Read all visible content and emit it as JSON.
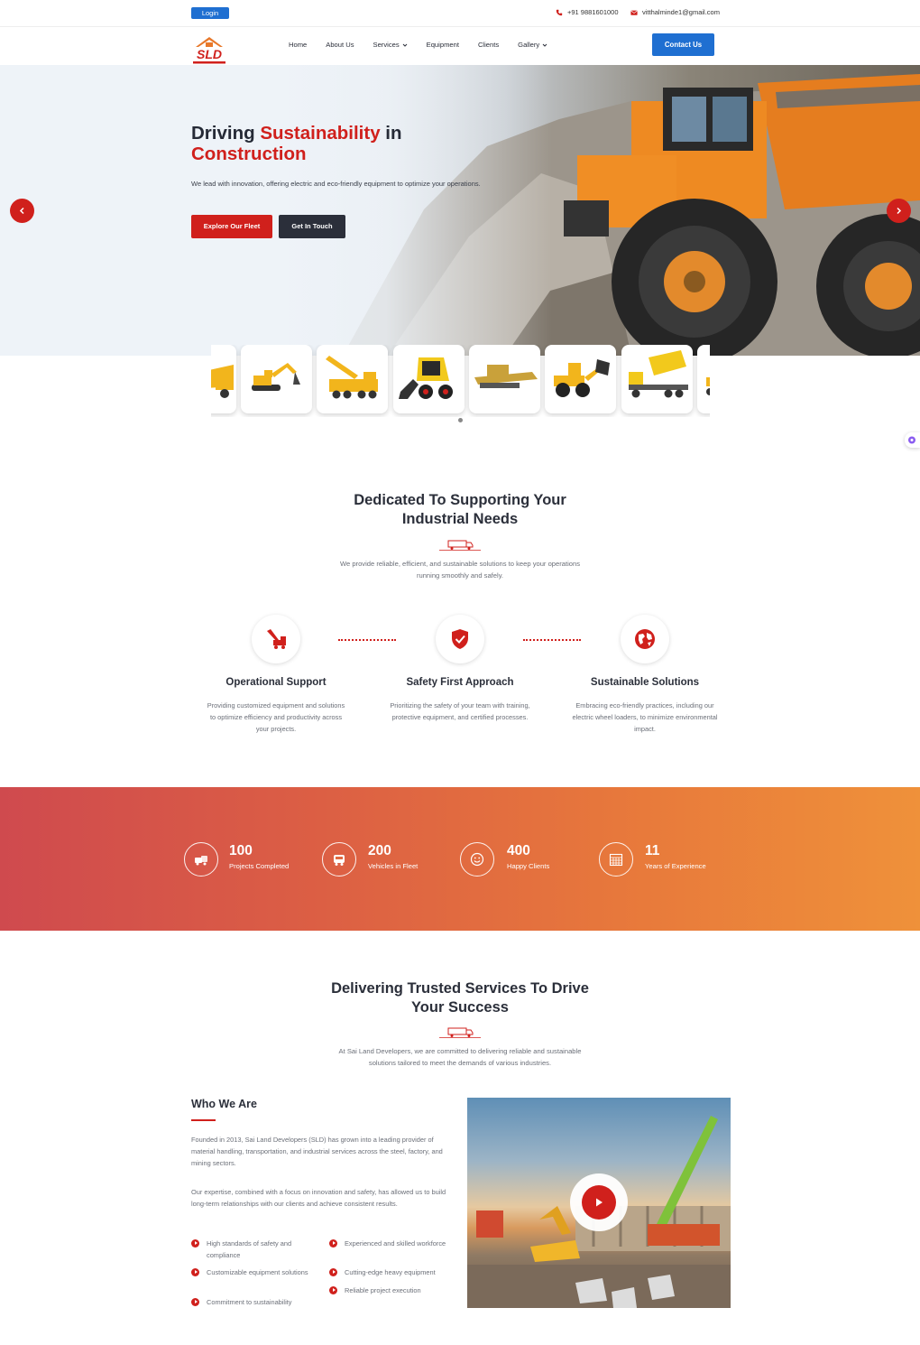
{
  "topbar": {
    "login_label": "Login",
    "phone": "+91 9881601000",
    "email": "vitthalminde1@gmail.com"
  },
  "nav": {
    "items": [
      {
        "label": "Home"
      },
      {
        "label": "About Us"
      },
      {
        "label": "Services",
        "dropdown": true
      },
      {
        "label": "Equipment"
      },
      {
        "label": "Clients"
      },
      {
        "label": "Gallery",
        "dropdown": true
      }
    ],
    "contact_label": "Contact Us"
  },
  "hero": {
    "title_part1": "Driving ",
    "title_highlight": "Sustainability",
    "title_part2": " in",
    "title_line2": "Construction",
    "subtitle": "We lead with innovation, offering electric and eco-friendly equipment to optimize your operations.",
    "primary_button": "Explore Our Fleet",
    "secondary_button": "Get In Touch"
  },
  "equipment_carousel": {
    "items": [
      "dump-truck",
      "excavator",
      "mobile-crane",
      "skid-steer-loader",
      "mobile-crusher",
      "wheel-loader",
      "tipper-truck",
      "dump-truck"
    ]
  },
  "support": {
    "title_line1": "Dedicated To Supporting Your",
    "title_line2": "Industrial Needs",
    "subtitle_line1": "We provide reliable, efficient, and sustainable solutions to keep your operations",
    "subtitle_line2": "running smoothly and safely.",
    "features": [
      {
        "icon": "crane-icon",
        "title": "Operational Support",
        "text": "Providing customized equipment and solutions to optimize efficiency and productivity across your projects."
      },
      {
        "icon": "shield-check-icon",
        "title": "Safety First Approach",
        "text": "Prioritizing the safety of your team with training, protective equipment, and certified processes."
      },
      {
        "icon": "globe-icon",
        "title": "Sustainable Solutions",
        "text": "Embracing eco-friendly practices, including our electric wheel loaders, to minimize environmental impact."
      }
    ]
  },
  "stats": [
    {
      "icon": "projects-icon",
      "number": "100",
      "label": "Projects Completed"
    },
    {
      "icon": "vehicle-icon",
      "number": "200",
      "label": "Vehicles in Fleet"
    },
    {
      "icon": "smile-icon",
      "number": "400",
      "label": "Happy Clients"
    },
    {
      "icon": "calendar-icon",
      "number": "11",
      "label": "Years of Experience"
    }
  ],
  "services": {
    "title_line1": "Delivering Trusted Services To Drive",
    "title_line2": "Your Success",
    "subtitle_line1": "At Sai Land Developers, we are committed to delivering reliable and sustainable",
    "subtitle_line2": "solutions tailored to meet the demands of various industries."
  },
  "who": {
    "title": "Who We Are",
    "para1": "Founded in 2013, Sai Land Developers (SLD) has grown into a leading provider of material handling, transportation, and industrial services across the steel, factory, and mining sectors.",
    "para2": "Our expertise, combined with a focus on innovation and safety, has allowed us to build long-term relationships with our clients and achieve consistent results.",
    "bullets_left": [
      "High standards of safety and compliance",
      "Customizable equipment solutions",
      "Commitment to sustainability"
    ],
    "bullets_right": [
      "Experienced and skilled workforce",
      "Cutting-edge heavy equipment",
      "Reliable project execution"
    ]
  },
  "colors": {
    "brand_red": "#d0201c",
    "brand_blue": "#1f6fd1",
    "dark": "#2b2f3a"
  }
}
